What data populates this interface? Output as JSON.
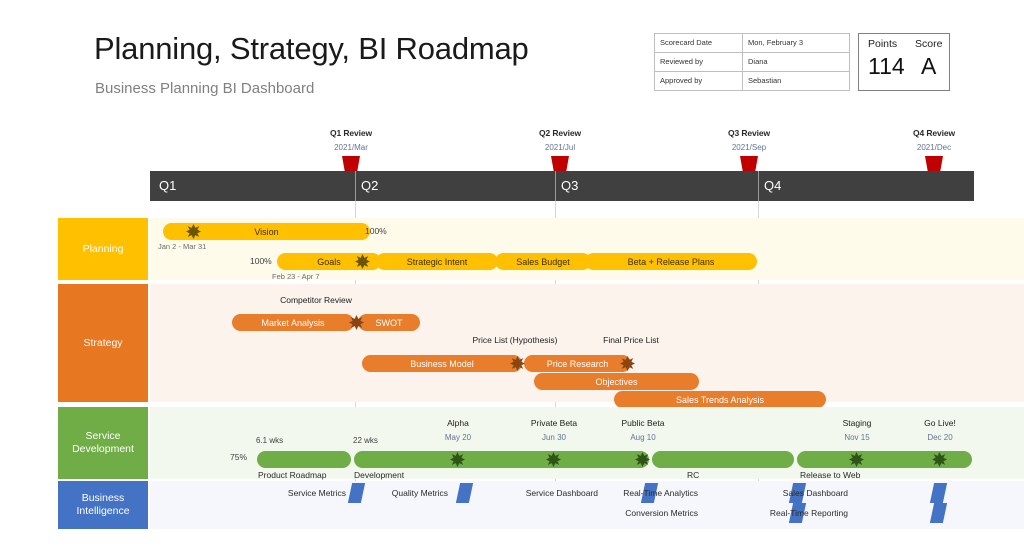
{
  "header": {
    "title": "Planning, Strategy, BI Roadmap",
    "subtitle": "Business Planning BI Dashboard"
  },
  "scorecard": {
    "rows": [
      {
        "key": "Scorecard Date",
        "value": "Mon, February 3"
      },
      {
        "key": "Reviewed by",
        "value": "Diana"
      },
      {
        "key": "Approved by",
        "value": "Sebastian"
      }
    ],
    "points_label": "Points",
    "score_label": "Score",
    "points_value": "114",
    "score_value": "A"
  },
  "reviews": [
    {
      "title": "Q1 Review",
      "date": "2021/Mar"
    },
    {
      "title": "Q2 Review",
      "date": "2021/Jul"
    },
    {
      "title": "Q3 Review",
      "date": "2021/Sep"
    },
    {
      "title": "Q4 Review",
      "date": "2021/Dec"
    }
  ],
  "quarters": [
    "Q1",
    "Q2",
    "Q3",
    "Q4"
  ],
  "lanes": [
    {
      "name": "Planning",
      "color": "#FFC000"
    },
    {
      "name": "Strategy",
      "color": "#E87722"
    },
    {
      "name": "Service\nDevelopment",
      "color": "#70AD47"
    },
    {
      "name": "Business\nIntelligence",
      "color": "#4472C4"
    }
  ],
  "planning": {
    "lane_line1": "Planning",
    "bars": [
      {
        "label": "Vision",
        "pct": "100%",
        "dates": "Jan 2  -  Mar 31"
      },
      {
        "label": "Goals",
        "pct": "100%",
        "dates": "Feb 23  -  Apr 7"
      },
      {
        "label": "Strategic Intent"
      },
      {
        "label": "Sales Budget"
      },
      {
        "label": "Beta + Release Plans"
      }
    ]
  },
  "strategy": {
    "lane_line1": "Strategy",
    "milestones": [
      {
        "label": "Competitor Review"
      },
      {
        "label": "Price List (Hypothesis)"
      },
      {
        "label": "Final Price List"
      }
    ],
    "bars": [
      {
        "label": "Market Analysis"
      },
      {
        "label": "SWOT"
      },
      {
        "label": "Business Model"
      },
      {
        "label": "Price Research"
      },
      {
        "label": "Objectives"
      },
      {
        "label": "Sales Trends Analysis"
      }
    ]
  },
  "service_development": {
    "lane_line1": "Service",
    "lane_line2": "Development",
    "pct": "75%",
    "durations": [
      "6.1 wks",
      "22 wks"
    ],
    "bars": [
      {
        "label": "Product Roadmap"
      },
      {
        "label": "Development"
      },
      {
        "label": "RC"
      },
      {
        "label": "Release to Web"
      }
    ],
    "milestones": [
      {
        "title": "Alpha",
        "date": "May 20"
      },
      {
        "title": "Private Beta",
        "date": "Jun 30"
      },
      {
        "title": "Public Beta",
        "date": "Aug 10"
      },
      {
        "title": "Staging",
        "date": "Nov 15"
      },
      {
        "title": "Go Live!",
        "date": "Dec 20"
      }
    ]
  },
  "business_intelligence": {
    "lane_line1": "Business",
    "lane_line2": "Intelligence",
    "items": [
      {
        "label": "Service Metrics"
      },
      {
        "label": "Quality Metrics"
      },
      {
        "label": "Service Dashboard"
      },
      {
        "label": "Real-Time Analytics"
      },
      {
        "label": "Conversion Metrics"
      },
      {
        "label": "Sales Dashboard"
      },
      {
        "label": "Real-Time Reporting"
      }
    ]
  }
}
